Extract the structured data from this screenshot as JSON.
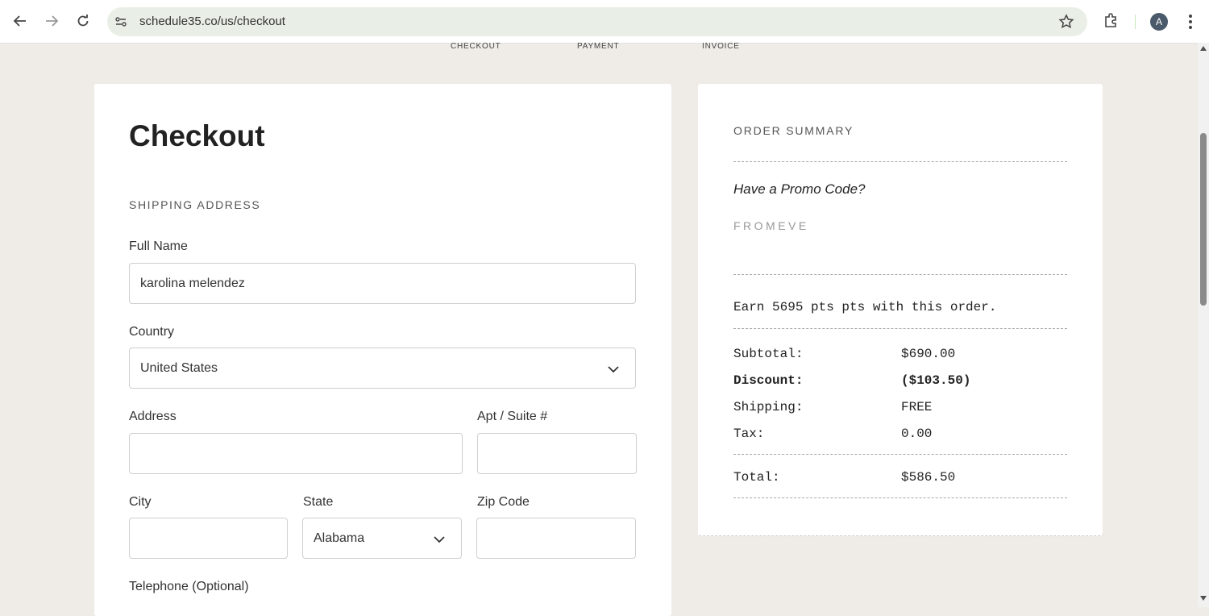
{
  "browser": {
    "url": "schedule35.co/us/checkout",
    "avatar_letter": "A",
    "icons": [
      "back-arrow-icon",
      "forward-arrow-icon",
      "reload-icon",
      "site-info-icon",
      "bookmark-star-icon",
      "extensions-icon",
      "more-menu-icon"
    ]
  },
  "steps": [
    "CHECKOUT",
    "PAYMENT",
    "INVOICE"
  ],
  "checkout": {
    "title": "Checkout",
    "shipping_label": "SHIPPING ADDRESS",
    "full_name_label": "Full Name",
    "full_name_value": "karolina melendez",
    "country_label": "Country",
    "country_value": "United States",
    "address_label": "Address",
    "address_value": "",
    "apt_label": "Apt / Suite #",
    "apt_value": "",
    "city_label": "City",
    "city_value": "",
    "state_label": "State",
    "state_value": "Alabama",
    "zip_label": "Zip Code",
    "zip_value": "",
    "telephone_label": "Telephone (Optional)"
  },
  "summary": {
    "title": "ORDER SUMMARY",
    "promo_question": "Have a Promo Code?",
    "promo_code": "FROMEVE",
    "earn_text": "Earn 5695 pts pts with this order.",
    "rows": [
      {
        "label": "Subtotal:",
        "value": "$690.00"
      },
      {
        "label": "Discount:",
        "value": "($103.50)"
      },
      {
        "label": "Shipping:",
        "value": "FREE"
      },
      {
        "label": "Tax:",
        "value": "0.00"
      }
    ],
    "total_label": "Total:",
    "total_value": "$586.50"
  },
  "colors": {
    "page_bg": "#efebe7",
    "omnibox_bg": "#e9efe6",
    "card_bg": "#ffffff"
  }
}
